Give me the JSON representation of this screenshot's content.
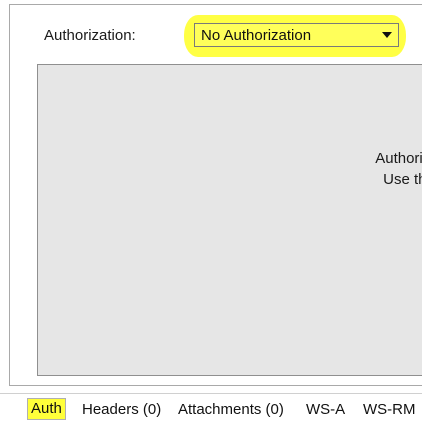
{
  "auth": {
    "label": "Authorization:",
    "selected": "No Authorization",
    "message_line1": "Authorizat",
    "message_line2": "Use the"
  },
  "tabs": [
    {
      "label": "Auth",
      "active": true
    },
    {
      "label": "Headers (0)",
      "active": false
    },
    {
      "label": "Attachments (0)",
      "active": false
    },
    {
      "label": "WS-A",
      "active": false
    },
    {
      "label": "WS-RM",
      "active": false
    }
  ],
  "colors": {
    "highlight": "#ffff3a",
    "panel_gray": "#e6e6e6"
  }
}
